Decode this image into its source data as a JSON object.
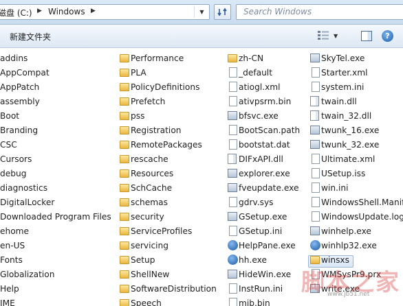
{
  "address": {
    "segments": [
      "磁盘 (C:)",
      "Windows"
    ],
    "search_placeholder": "Search Windows"
  },
  "toolbar": {
    "new_folder": "新建文件夹",
    "views_icon": "views-icon",
    "preview_icon": "preview-pane-icon",
    "help_icon": "help-icon"
  },
  "columns": [
    [
      "addins",
      "AppCompat",
      "AppPatch",
      "assembly",
      "Boot",
      "Branding",
      "CSC",
      "Cursors",
      "debug",
      "diagnostics",
      "DigitalLocker",
      "Downloaded Program Files",
      "ehome",
      "en-US",
      "Fonts",
      "Globalization",
      "Help",
      "IME"
    ],
    [
      "Performance",
      "PLA",
      "PolicyDefinitions",
      "Prefetch",
      "pss",
      "Registration",
      "RemotePackages",
      "rescache",
      "Resources",
      "SchCache",
      "schemas",
      "security",
      "ServiceProfiles",
      "servicing",
      "Setup",
      "ShellNew",
      "SoftwareDistribution",
      "Speech"
    ],
    [
      "zh-CN",
      "_default",
      "atiogl.xml",
      "ativpsrm.bin",
      "bfsvc.exe",
      "BootScan.path",
      "bootstat.dat",
      "DIFxAPI.dll",
      "explorer.exe",
      "fveupdate.exe",
      "gdrv.sys",
      "GSetup.exe",
      "GSetup.ini",
      "HelpPane.exe",
      "hh.exe",
      "HideWin.exe",
      "InstRun.ini",
      "mib.bin"
    ],
    [
      "SkyTel.exe",
      "Starter.xml",
      "system.ini",
      "twain.dll",
      "twain_32.dll",
      "twunk_16.exe",
      "twunk_32.exe",
      "Ultimate.xml",
      "USetup.iss",
      "win.ini",
      "WindowsShell.Manifest",
      "WindowsUpdate.log",
      "winhelp.exe",
      "winhlp32.exe",
      "winsxs",
      "WMSysPr9.prx",
      "write.exe"
    ]
  ],
  "watermark": {
    "text": "脚本之家",
    "url": "www.jb51.net"
  }
}
